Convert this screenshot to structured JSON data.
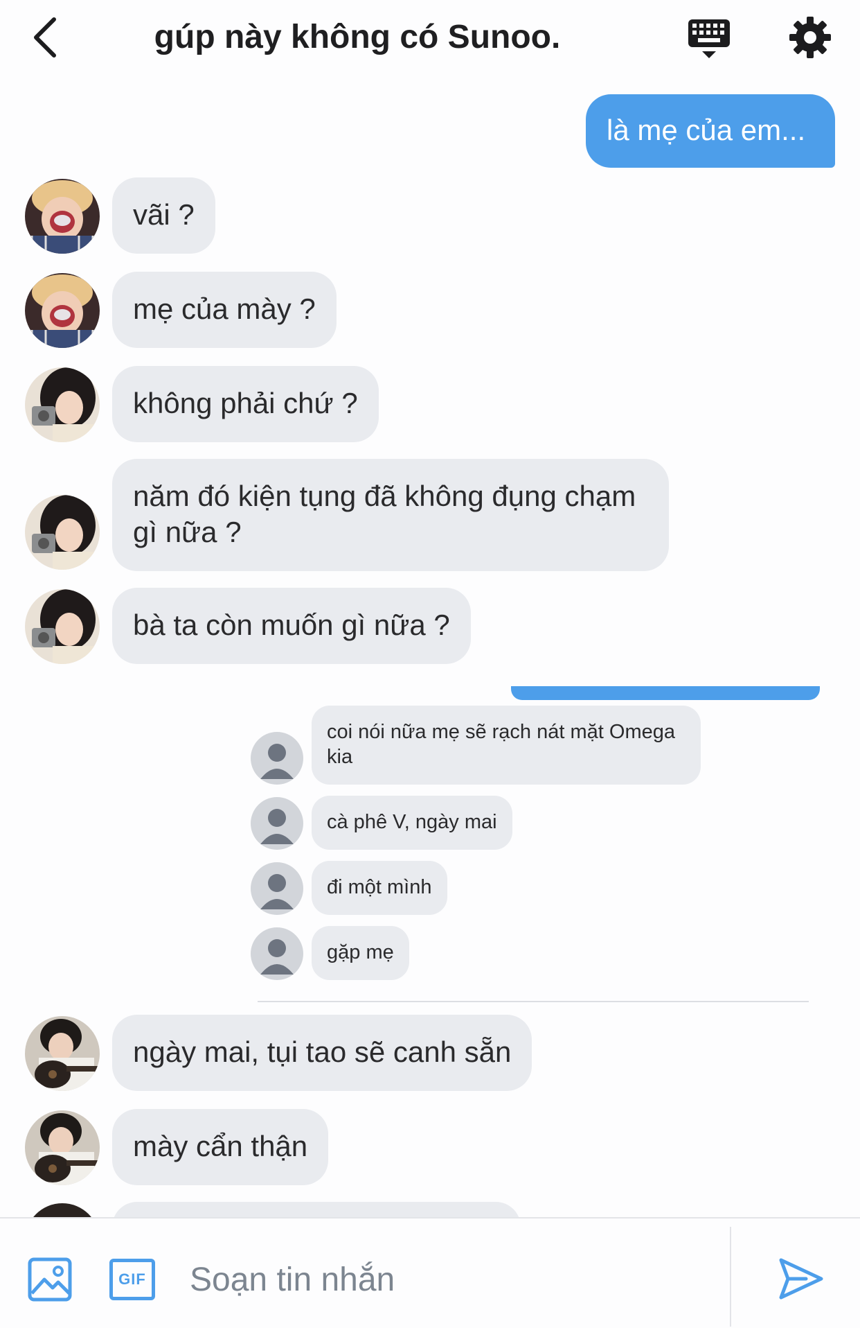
{
  "header": {
    "title": "gúp này không có Sunoo."
  },
  "icons": {
    "back": "chevron-left-icon",
    "keyboard": "keyboard-icon",
    "settings": "gear-icon",
    "image": "image-icon",
    "gif": "gif-icon",
    "send": "paper-plane-icon"
  },
  "colors": {
    "accent": "#4d9eea",
    "bubble_received": "#e9ebef",
    "background": "#fdfdfe"
  },
  "messages": [
    {
      "text": "là mẹ của em...",
      "sender": "me"
    },
    {
      "text": "vãi ?",
      "sender": "member-blonde"
    },
    {
      "text": "mẹ của mày ?",
      "sender": "member-blonde"
    },
    {
      "text": "không phải chứ ?",
      "sender": "member-girl"
    },
    {
      "text": "năm đó kiện tụng đã không đụng chạm gì nữa ?",
      "sender": "member-girl"
    },
    {
      "text": "bà ta còn muốn gì nữa ?",
      "sender": "member-girl"
    },
    {
      "text": "ngày mai, tụi tao sẽ canh sẵn",
      "sender": "member-guitar"
    },
    {
      "text": "mày cẩn thận",
      "sender": "member-guitar"
    }
  ],
  "forwarded_screenshot": {
    "messages": [
      "coi nói nữa mẹ sẽ rạch nát mặt Omega kia",
      "cà phê V, ngày mai",
      "đi một mình",
      "gặp mẹ"
    ]
  },
  "composer": {
    "gif_label": "GIF",
    "placeholder": "Soạn tin nhắn"
  }
}
